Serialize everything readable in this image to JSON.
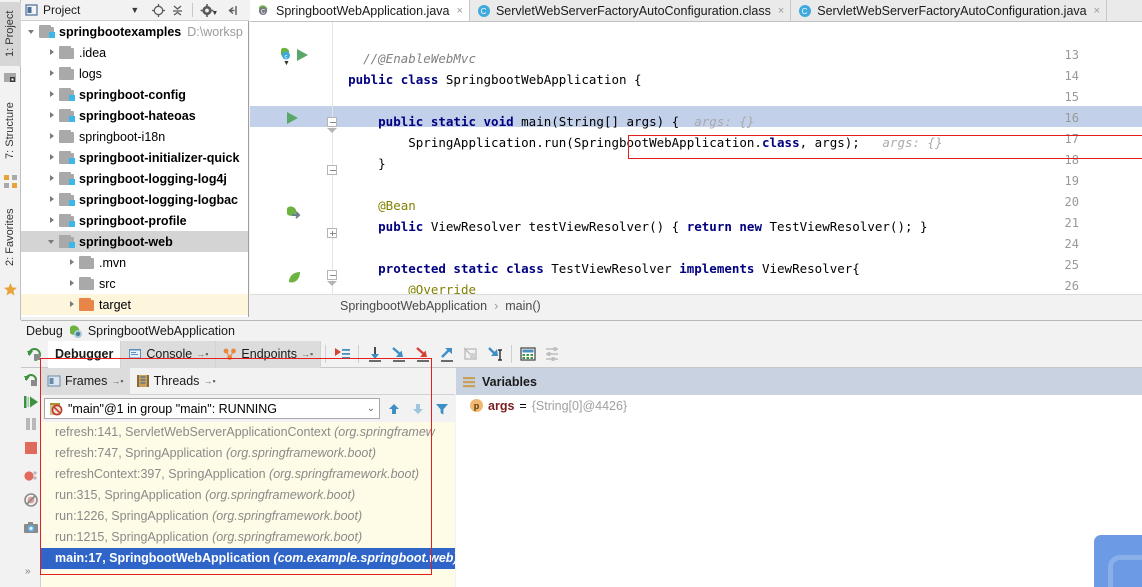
{
  "window": {
    "left_tabs": [
      {
        "label": "1: Project",
        "icon": "project-icon",
        "selected": true
      },
      {
        "label": "7: Structure",
        "icon": "structure-icon",
        "selected": false
      },
      {
        "label": "2: Favorites",
        "icon": "star-icon",
        "selected": false
      }
    ]
  },
  "project_panel": {
    "title": "Project",
    "header_icons": [
      "chevron-down-icon",
      "locate-icon",
      "collapse-all-icon",
      "gear-icon",
      "hide-icon"
    ],
    "tree": [
      {
        "label": "springbootexamples",
        "path": "D:\\worksp",
        "bold": true,
        "arrow": "open",
        "icon": "module-folder",
        "depth": 0,
        "state": "normal"
      },
      {
        "label": ".idea",
        "bold": false,
        "arrow": "closed",
        "icon": "folder",
        "depth": 1,
        "state": "normal"
      },
      {
        "label": "logs",
        "bold": false,
        "arrow": "closed",
        "icon": "folder",
        "depth": 1,
        "state": "normal"
      },
      {
        "label": "springboot-config",
        "bold": true,
        "arrow": "closed",
        "icon": "module-folder",
        "depth": 1,
        "state": "normal"
      },
      {
        "label": "springboot-hateoas",
        "bold": true,
        "arrow": "closed",
        "icon": "module-folder",
        "depth": 1,
        "state": "normal"
      },
      {
        "label": "springboot-i18n",
        "bold": false,
        "arrow": "closed",
        "icon": "folder",
        "depth": 1,
        "state": "normal"
      },
      {
        "label": "springboot-initializer-quick",
        "bold": true,
        "arrow": "closed",
        "icon": "module-folder",
        "depth": 1,
        "state": "normal"
      },
      {
        "label": "springboot-logging-log4j",
        "bold": true,
        "arrow": "closed",
        "icon": "module-folder",
        "depth": 1,
        "state": "normal"
      },
      {
        "label": "springboot-logging-logbac",
        "bold": true,
        "arrow": "closed",
        "icon": "module-folder",
        "depth": 1,
        "state": "normal"
      },
      {
        "label": "springboot-profile",
        "bold": true,
        "arrow": "closed",
        "icon": "module-folder",
        "depth": 1,
        "state": "normal"
      },
      {
        "label": "springboot-web",
        "bold": true,
        "arrow": "open",
        "icon": "module-folder",
        "depth": 1,
        "state": "selected"
      },
      {
        "label": ".mvn",
        "bold": false,
        "arrow": "closed",
        "icon": "folder",
        "depth": 2,
        "state": "normal"
      },
      {
        "label": "src",
        "bold": false,
        "arrow": "closed",
        "icon": "folder",
        "depth": 2,
        "state": "normal"
      },
      {
        "label": "target",
        "bold": false,
        "arrow": "closed",
        "icon": "folder-orange",
        "depth": 2,
        "state": "highlight"
      }
    ]
  },
  "editor_tabs": [
    {
      "label": "SpringbootWebApplication.java",
      "icon": "java-class-icon",
      "active": true,
      "close": "×"
    },
    {
      "label": "ServletWebServerFactoryAutoConfiguration.class",
      "icon": "compiled-class-icon",
      "active": false,
      "close": "×"
    },
    {
      "label": "ServletWebServerFactoryAutoConfiguration.java",
      "icon": "compiled-class-icon",
      "active": false,
      "close": "×"
    }
  ],
  "editor": {
    "line_numbers": [
      "13",
      "14",
      "15",
      "16",
      "17",
      "18",
      "19",
      "20",
      "21",
      "24",
      "25",
      "26"
    ],
    "lines": [
      {
        "n": "13",
        "tokens": [
          {
            "t": "    //@EnableWebMvc",
            "c": "cm"
          }
        ]
      },
      {
        "n": "14",
        "tokens": [
          {
            "t": "  ",
            "c": ""
          },
          {
            "t": "public class ",
            "c": "kw"
          },
          {
            "t": "SpringbootWebApplication {",
            "c": ""
          }
        ]
      },
      {
        "n": "15",
        "tokens": []
      },
      {
        "n": "16",
        "tokens": [
          {
            "t": "      ",
            "c": ""
          },
          {
            "t": "public static void ",
            "c": "kw"
          },
          {
            "t": "main(String[] args) {  ",
            "c": ""
          },
          {
            "t": "args: {}",
            "c": "hint"
          }
        ]
      },
      {
        "n": "17",
        "tokens": [
          {
            "t": "          SpringApplication.run(SpringbootWebApplication.",
            "c": ""
          },
          {
            "t": "class",
            "c": "kw"
          },
          {
            "t": ", args);   ",
            "c": ""
          },
          {
            "t": "args: {}",
            "c": "hint"
          }
        ]
      },
      {
        "n": "18",
        "tokens": [
          {
            "t": "      }",
            "c": ""
          }
        ]
      },
      {
        "n": "19",
        "tokens": []
      },
      {
        "n": "20",
        "tokens": [
          {
            "t": "      ",
            "c": ""
          },
          {
            "t": "@Bean",
            "c": "an"
          }
        ]
      },
      {
        "n": "21",
        "tokens": [
          {
            "t": "      ",
            "c": ""
          },
          {
            "t": "public ",
            "c": "kw"
          },
          {
            "t": "ViewResolver testViewResolver() { ",
            "c": ""
          },
          {
            "t": "return new ",
            "c": "kw"
          },
          {
            "t": "TestViewResolver(); }",
            "c": ""
          }
        ]
      },
      {
        "n": "24",
        "tokens": []
      },
      {
        "n": "25",
        "tokens": [
          {
            "t": "      ",
            "c": ""
          },
          {
            "t": "protected static class ",
            "c": "kw"
          },
          {
            "t": "TestViewResolver ",
            "c": ""
          },
          {
            "t": "implements ",
            "c": "kw"
          },
          {
            "t": "ViewResolver{",
            "c": ""
          }
        ]
      },
      {
        "n": "26",
        "tokens": [
          {
            "t": "          ",
            "c": ""
          },
          {
            "t": "@Override",
            "c": "an"
          }
        ]
      }
    ],
    "gutter_icons": [
      {
        "line": "14",
        "icon": "spring-bean-run-icon"
      },
      {
        "line": "16",
        "icon": "run-gutter-icon"
      },
      {
        "line": "20",
        "icon": "spring-bean-navigate-icon"
      },
      {
        "line": "25",
        "icon": "spring-leaf-icon"
      }
    ]
  },
  "breadcrumb": {
    "items": [
      "SpringbootWebApplication",
      "main()"
    ],
    "separator": "›"
  },
  "debug": {
    "title_prefix": "Debug",
    "config_name": "SpringbootWebApplication",
    "tabs": [
      {
        "label": "Debugger",
        "icon": "debugger-icon",
        "active": true
      },
      {
        "label": "Console",
        "icon": "console-icon",
        "active": false,
        "pin": "→•"
      },
      {
        "label": "Endpoints",
        "icon": "endpoints-icon",
        "active": false,
        "pin": "→•"
      }
    ],
    "toolbar_icons": [
      "show-execution-point-icon",
      "step-over-icon",
      "step-into-icon",
      "force-step-into-icon",
      "step-out-icon",
      "drop-frame-icon",
      "run-to-cursor-icon",
      "evaluate-expression-icon",
      "settings-icon"
    ],
    "left_strip_icons": [
      "rerun-icon",
      "resume-program-icon",
      "pause-program-icon",
      "stop-icon",
      "view-breakpoints-icon",
      "mute-breakpoints-icon",
      "capture-snapshot-icon",
      "more-icon"
    ],
    "frames": {
      "tabs": [
        {
          "label": "Frames",
          "icon": "frames-icon",
          "active": true,
          "pin": "→•"
        },
        {
          "label": "Threads",
          "icon": "threads-icon",
          "active": false,
          "pin": "→•"
        }
      ],
      "thread_selector": "\"main\"@1 in group \"main\": RUNNING",
      "thread_icon": "thread-suspended-icon",
      "nav_icons": [
        "arrow-up-icon",
        "arrow-down-icon",
        "filter-icon"
      ],
      "stack": [
        {
          "method": "refresh:141, ServletWebServerApplicationContext",
          "package": "(org.springframew",
          "selected": false
        },
        {
          "method": "refresh:747, SpringApplication",
          "package": "(org.springframework.boot)",
          "selected": false
        },
        {
          "method": "refreshContext:397, SpringApplication",
          "package": "(org.springframework.boot)",
          "selected": false
        },
        {
          "method": "run:315, SpringApplication",
          "package": "(org.springframework.boot)",
          "selected": false
        },
        {
          "method": "run:1226, SpringApplication",
          "package": "(org.springframework.boot)",
          "selected": false
        },
        {
          "method": "run:1215, SpringApplication",
          "package": "(org.springframework.boot)",
          "selected": false
        },
        {
          "method": "main:17, SpringbootWebApplication",
          "package": "(com.example.springboot.web)",
          "selected": true
        }
      ]
    },
    "variables": {
      "title": "Variables",
      "icon": "variables-icon",
      "rows": [
        {
          "badge": "p",
          "name": "args",
          "eq": "=",
          "value": "{String[0]@4426}"
        }
      ]
    }
  },
  "annotations": {
    "accent_red": "#e32020",
    "selection_blue": "#2f65c8",
    "highlight_yellow": "#fefbe6"
  }
}
